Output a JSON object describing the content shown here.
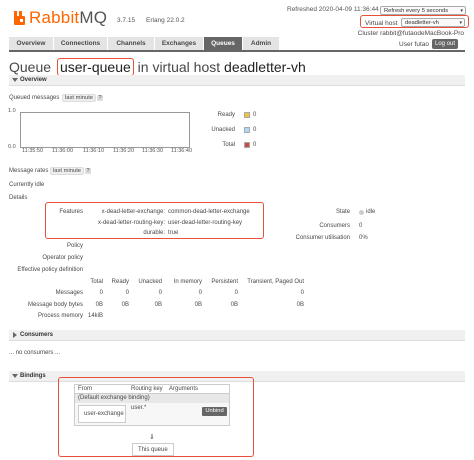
{
  "header": {
    "brand_rabbit": "Rabbit",
    "brand_mq": "MQ",
    "version": "3.7.15",
    "erlang": "Erlang 22.0.2",
    "refreshed": "Refreshed 2020-04-09 11:36:44",
    "refresh_select": "Refresh every 5 seconds",
    "vhost_label": "Virtual host",
    "vhost_value": "deadletter-vh",
    "cluster": "Cluster rabbit@futaodeMacBook-Pro",
    "user_label": "User futao",
    "logout": "Log out"
  },
  "tabs": [
    "Overview",
    "Connections",
    "Channels",
    "Exchanges",
    "Queues",
    "Admin"
  ],
  "title": {
    "prefix": "Queue",
    "queue_name": "user-queue",
    "middle": "in virtual host",
    "vhost": "deadletter-vh"
  },
  "overview": {
    "section_title": "Overview",
    "queued_messages_label": "Queued messages",
    "queued_range": "last minute",
    "help": "?",
    "chart_y_top": "1.0",
    "chart_y_bottom": "0.0",
    "chart_x_ticks": [
      "11:35:50",
      "11:36:00",
      "11:36:10",
      "11:36:20",
      "11:36:30",
      "11:36:40"
    ],
    "legend": [
      {
        "label": "Ready",
        "value": "0",
        "color": "#edc240"
      },
      {
        "label": "Unacked",
        "value": "0",
        "color": "#afd8f8"
      },
      {
        "label": "Total",
        "value": "0",
        "color": "#cb4b4b"
      }
    ],
    "message_rates_label": "Message rates",
    "message_rates_range": "last minute",
    "currently": "Currently idle",
    "details": "Details"
  },
  "features": {
    "label": "Features",
    "rows": [
      {
        "key": "x-dead-letter-exchange:",
        "value": "common-dead-letter-exchange"
      },
      {
        "key": "x-dead-letter-routing-key:",
        "value": "user-dead-letter-routing-key"
      },
      {
        "key": "durable:",
        "value": "true"
      }
    ]
  },
  "state": {
    "state_label": "State",
    "state_value": "idle",
    "consumers_label": "Consumers",
    "consumers_value": "0",
    "utilisation_label": "Consumer utilisation",
    "utilisation_value": "0%"
  },
  "policy": {
    "policy": "Policy",
    "operator_policy": "Operator policy",
    "effective_policy": "Effective policy definition"
  },
  "stats": {
    "headers": [
      "Total",
      "Ready",
      "Unacked",
      "In memory",
      "Persistent",
      "Transient, Paged Out"
    ],
    "rows": [
      {
        "label": "Messages",
        "values": [
          "0",
          "0",
          "0",
          "0",
          "0",
          "0"
        ]
      },
      {
        "label": "Message body bytes",
        "values": [
          "0B",
          "0B",
          "0B",
          "0B",
          "0B",
          "0B"
        ]
      },
      {
        "label": "Process memory",
        "values": [
          "14kiB"
        ]
      }
    ]
  },
  "consumers": {
    "section_title": "Consumers",
    "empty": "... no consumers ..."
  },
  "bindings": {
    "section_title": "Bindings",
    "headers": [
      "From",
      "Routing key",
      "Arguments"
    ],
    "default_binding": "(Default exchange binding)",
    "rows": [
      {
        "from": "user-exchange",
        "routing_key": "user.*",
        "arguments": "",
        "action": "Unbind"
      }
    ],
    "arrow": "⇓",
    "this_queue": "This queue"
  }
}
